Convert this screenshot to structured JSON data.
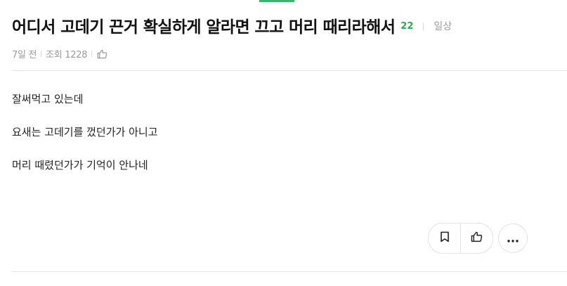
{
  "post": {
    "title": "어디서 고데기 끈거 확실하게 알라면 끄고 머리 때리라해서",
    "comment_count": "22",
    "category": "일상",
    "meta": {
      "time": "7일 전",
      "views": "조회 1228"
    },
    "body": [
      "잘써먹고 있는데",
      "요새는 고데기를 껐던가가 아니고",
      "머리 때렸던가가 기억이 안나네"
    ]
  },
  "icons": {
    "like_small": "thumbs-up-icon",
    "bookmark": "bookmark-icon",
    "like": "thumbs-up-icon",
    "more": "more-horizontal-icon"
  },
  "colors": {
    "accent_green": "#2eaa4f",
    "muted_text": "#9a9a9a",
    "border": "#e3e3e3"
  }
}
